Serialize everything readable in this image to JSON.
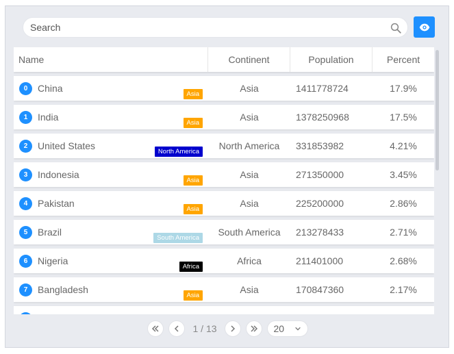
{
  "search": {
    "placeholder": "Search"
  },
  "columns": {
    "name": "Name",
    "continent": "Continent",
    "population": "Population",
    "percent": "Percent"
  },
  "rows": [
    {
      "index": "0",
      "name": "China",
      "tag": "Asia",
      "tag_color": "#ffa500",
      "continent": "Asia",
      "population": "1411778724",
      "percent": "17.9%"
    },
    {
      "index": "1",
      "name": "India",
      "tag": "Asia",
      "tag_color": "#ffa500",
      "continent": "Asia",
      "population": "1378250968",
      "percent": "17.5%"
    },
    {
      "index": "2",
      "name": "United States",
      "tag": "North America",
      "tag_color": "#0000cd",
      "continent": "North America",
      "population": "331853982",
      "percent": "4.21%"
    },
    {
      "index": "3",
      "name": "Indonesia",
      "tag": "Asia",
      "tag_color": "#ffa500",
      "continent": "Asia",
      "population": "271350000",
      "percent": "3.45%"
    },
    {
      "index": "4",
      "name": "Pakistan",
      "tag": "Asia",
      "tag_color": "#ffa500",
      "continent": "Asia",
      "population": "225200000",
      "percent": "2.86%"
    },
    {
      "index": "5",
      "name": "Brazil",
      "tag": "South America",
      "tag_color": "#add8e6",
      "continent": "South America",
      "population": "213278433",
      "percent": "2.71%"
    },
    {
      "index": "6",
      "name": "Nigeria",
      "tag": "Africa",
      "tag_color": "#000000",
      "continent": "Africa",
      "population": "211401000",
      "percent": "2.68%"
    },
    {
      "index": "7",
      "name": "Bangladesh",
      "tag": "Asia",
      "tag_color": "#ffa500",
      "continent": "Asia",
      "population": "170847360",
      "percent": "2.17%"
    }
  ],
  "pagination": {
    "page_info": "1 / 13",
    "page_size": "20"
  },
  "colors": {
    "accent": "#1e90ff"
  }
}
